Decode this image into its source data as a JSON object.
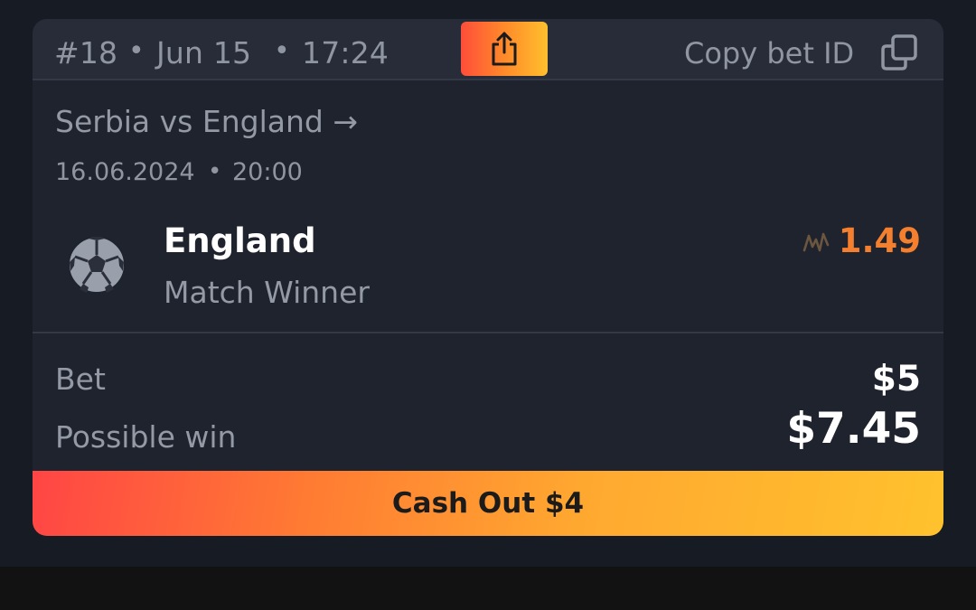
{
  "header": {
    "bet_number": "#18",
    "date": "Jun 15",
    "time": "17:24",
    "separator": "•",
    "share_icon": "share-icon",
    "copy_label": "Copy bet ID",
    "copy_icon": "copy-icon"
  },
  "match": {
    "title": "Serbia vs England →",
    "date": "16.06.2024",
    "time": "20:00",
    "separator": "•"
  },
  "selection": {
    "sport_icon": "soccer-ball-icon",
    "team": "England",
    "market": "Match Winner",
    "odds_icon": "odds-trend-icon",
    "odds": "1.49"
  },
  "summary": {
    "bet_label": "Bet",
    "bet_value": "$5",
    "win_label": "Possible win",
    "win_value": "$7.45"
  },
  "cashout": {
    "label": "Cash Out $4"
  },
  "colors": {
    "card_bg": "#1f232d",
    "header_bg": "#272c38",
    "accent_orange": "#f47f2e",
    "gradient_start": "#ff4545",
    "gradient_end": "#ffc22d"
  }
}
